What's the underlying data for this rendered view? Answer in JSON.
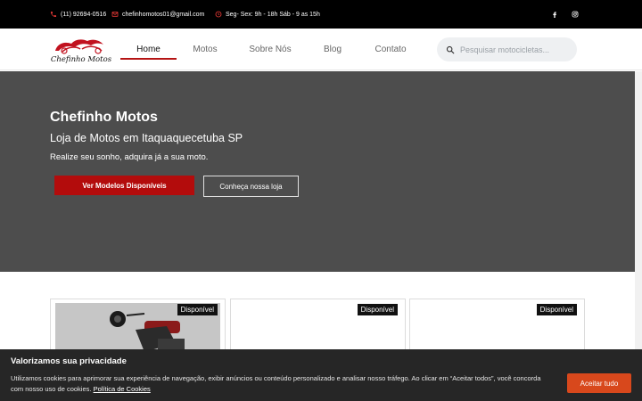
{
  "topbar": {
    "phone": "(11) 92694-0516",
    "email": "chefinhomotos01@gmail.com",
    "hours": "Seg- Sex: 9h - 18h Sáb - 9 as 15h",
    "icons": [
      "phone-icon",
      "mail-icon",
      "clock-icon",
      "facebook-icon",
      "instagram-icon"
    ]
  },
  "header": {
    "logo_text": "Chefinho Motos",
    "nav": [
      {
        "label": "Home",
        "active": true
      },
      {
        "label": "Motos"
      },
      {
        "label": "Sobre Nós"
      },
      {
        "label": "Blog"
      },
      {
        "label": "Contato"
      }
    ],
    "search_placeholder": "Pesquisar motocicletas..."
  },
  "hero": {
    "title": "Chefinho Motos",
    "subtitle": "Loja de Motos em Itaquaquecetuba SP",
    "text": "Realize seu sonho, adquira já a sua moto.",
    "primary_button": "Ver Modelos Disponíveis",
    "secondary_button": "Conheça nossa loja"
  },
  "cards": [
    {
      "badge": "Disponível"
    },
    {
      "badge": "Disponível"
    },
    {
      "badge": "Disponível"
    }
  ],
  "cookie": {
    "title": "Valorizamos sua privacidade",
    "text": "Utilizamos cookies para aprimorar sua experiência de navegação, exibir anúncios ou conteúdo personalizado e analisar nosso tráfego. Ao clicar em “Aceitar todos”, você concorda com nosso uso de cookies.",
    "link": "Política de Cookies",
    "button": "Aceitar tudo"
  },
  "colors": {
    "accent": "#b30c0c",
    "hero_bg": "#4d4d4d",
    "cookie_bg": "#262626",
    "cookie_button": "#d8481c"
  }
}
